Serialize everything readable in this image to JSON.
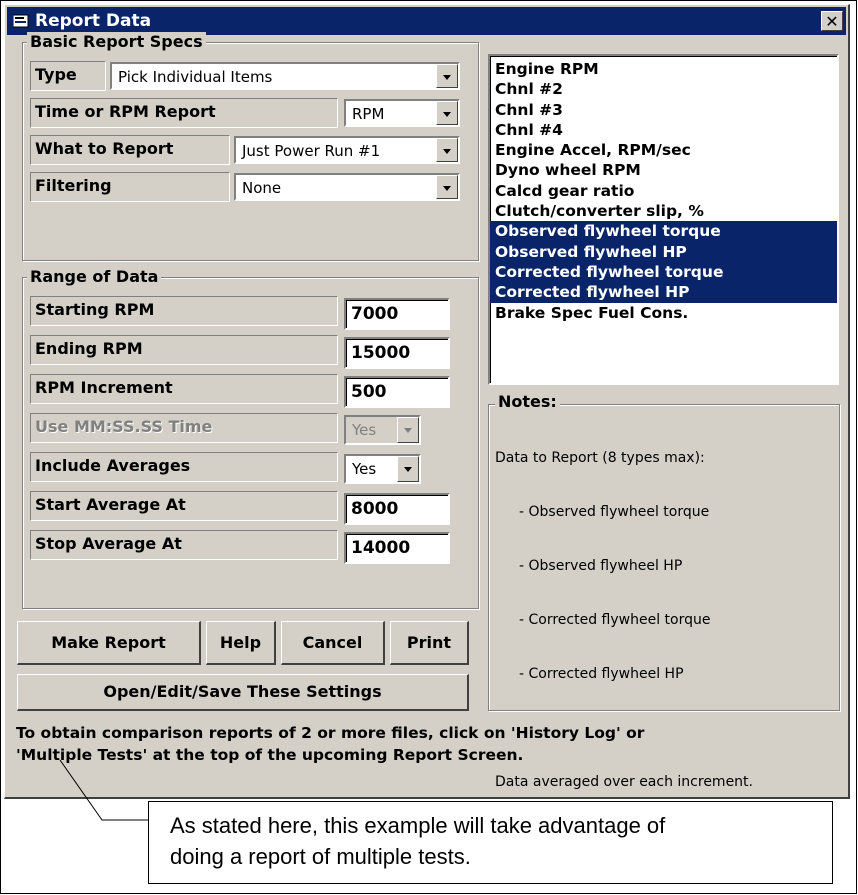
{
  "window": {
    "title": "Report Data",
    "close_glyph": "✕"
  },
  "basic": {
    "group_label": "Basic Report Specs",
    "type_label": "Type",
    "type_value": "Pick Individual Items",
    "time_rpm_label": "Time or RPM Report",
    "time_rpm_value": "RPM",
    "what_label": "What to Report",
    "what_value": "Just Power Run #1",
    "filter_label": "Filtering",
    "filter_value": "None"
  },
  "range": {
    "group_label": "Range of Data",
    "rows": [
      {
        "label": "Starting RPM",
        "value": "7000"
      },
      {
        "label": "Ending RPM",
        "value": "15000"
      },
      {
        "label": "RPM Increment",
        "value": "500"
      },
      {
        "label": "Use MM:SS.SS Time",
        "value": "Yes"
      },
      {
        "label": "Include Averages",
        "value": "Yes"
      },
      {
        "label": "Start Average At",
        "value": "8000"
      },
      {
        "label": "Stop Average At",
        "value": "14000"
      }
    ]
  },
  "buttons": {
    "make_report": "Make Report",
    "help": "Help",
    "cancel": "Cancel",
    "print": "Print",
    "settings": "Open/Edit/Save These Settings"
  },
  "list": {
    "items": [
      {
        "label": "Engine RPM",
        "selected": false
      },
      {
        "label": "Chnl #2",
        "selected": false
      },
      {
        "label": "Chnl #3",
        "selected": false
      },
      {
        "label": "Chnl #4",
        "selected": false
      },
      {
        "label": "Engine Accel, RPM/sec",
        "selected": false
      },
      {
        "label": "Dyno wheel RPM",
        "selected": false
      },
      {
        "label": "Calcd gear ratio",
        "selected": false
      },
      {
        "label": "Clutch/converter slip, %",
        "selected": false
      },
      {
        "label": "Observed flywheel torque",
        "selected": true
      },
      {
        "label": "Observed flywheel HP",
        "selected": true
      },
      {
        "label": "Corrected flywheel torque",
        "selected": true
      },
      {
        "label": "Corrected flywheel HP",
        "selected": true
      },
      {
        "label": "Brake Spec Fuel Cons.",
        "selected": false
      }
    ]
  },
  "notes": {
    "group_label": "Notes:",
    "header": "Data to Report (8 types max):",
    "items": [
      "- Observed flywheel torque",
      "- Observed flywheel HP",
      "- Corrected flywheel torque",
      "- Corrected flywheel HP"
    ],
    "footer": "Data averaged over each increment."
  },
  "footer": {
    "line1": "To obtain comparison reports of 2 or more files, click on 'History Log' or",
    "line2": "'Multiple Tests' at the top of the upcoming Report Screen."
  },
  "callout": {
    "line1": "As stated here, this example will take advantage of",
    "line2": "doing a report of multiple tests."
  },
  "colors": {
    "face": "#d4d0c8",
    "selection": "#0a246a",
    "titlebar": "#0a246a"
  }
}
